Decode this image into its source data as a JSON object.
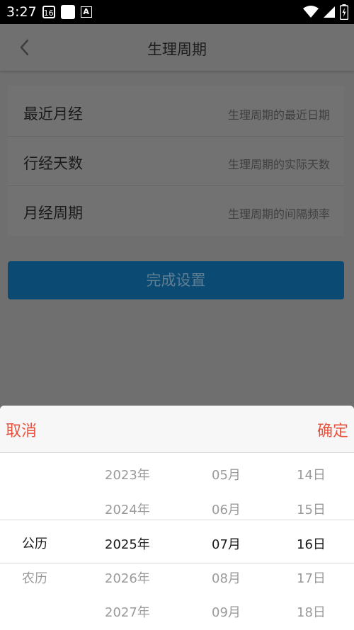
{
  "status_bar": {
    "time": "3:27",
    "calendar_icon_text": "16",
    "a_icon_text": "A"
  },
  "header": {
    "title": "生理周期"
  },
  "form": {
    "rows": [
      {
        "label": "最近月经",
        "hint": "生理周期的最近日期"
      },
      {
        "label": "行经天数",
        "hint": "生理周期的实际天数"
      },
      {
        "label": "月经周期",
        "hint": "生理周期的间隔频率"
      }
    ],
    "submit_label": "完成设置"
  },
  "picker_sheet": {
    "cancel_label": "取消",
    "confirm_label": "确定",
    "calendar_types": [
      "公历",
      "农历"
    ],
    "years": [
      "2023年",
      "2024年",
      "2025年",
      "2026年",
      "2027年"
    ],
    "months": [
      "05月",
      "06月",
      "07月",
      "08月",
      "09月"
    ],
    "days": [
      "14日",
      "15日",
      "16日",
      "17日",
      "18日"
    ],
    "selected": {
      "calendar_type": "公历",
      "year": "2025年",
      "month": "07月",
      "day": "16日"
    }
  },
  "colors": {
    "accent": "#e8513c",
    "button": "#0b4a72",
    "overlay": "#6f6f6f"
  }
}
